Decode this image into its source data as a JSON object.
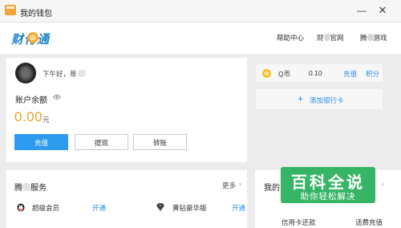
{
  "window": {
    "title": "我的钱包",
    "minimize_glyph": "—",
    "close_glyph": "✕"
  },
  "header": {
    "logo_text": "财付通",
    "links": {
      "help": "帮助中心",
      "site_prefix": "财",
      "site_suffix": "官网",
      "game_prefix": "腾",
      "game_suffix": "游戏"
    }
  },
  "account": {
    "greeting": "下午好，蒂",
    "balance_label": "账户余额",
    "balance_amount": "0.00",
    "balance_unit": "元",
    "buttons": {
      "recharge": "充值",
      "withdraw": "提现",
      "transfer": "转账"
    }
  },
  "qcoin": {
    "label": "Q币",
    "value": "0.10",
    "recharge": "充值",
    "points": "积分"
  },
  "bank_card": {
    "plus": "+",
    "label": "添加银行卡"
  },
  "services": {
    "title_prefix": "腾",
    "title_suffix": "服务",
    "more": "更多",
    "chevron": "›",
    "items": [
      {
        "name": "超级会员",
        "action": "开通",
        "icon": "penguin-icon"
      },
      {
        "name": "黄钻豪华版",
        "action": "开通",
        "icon": "diamond-icon"
      }
    ]
  },
  "mine": {
    "title": "我的",
    "chevron": "›",
    "items": [
      {
        "name": "信用卡还款"
      },
      {
        "name": "话费充值"
      }
    ]
  },
  "watermark": {
    "title": "百科全说",
    "subtitle": "助你轻松解决"
  },
  "colors": {
    "primary_blue": "#2e9bf0",
    "link_blue": "#2e8be6",
    "balance_orange": "#f0a226",
    "watermark_green": "#28af5a"
  }
}
